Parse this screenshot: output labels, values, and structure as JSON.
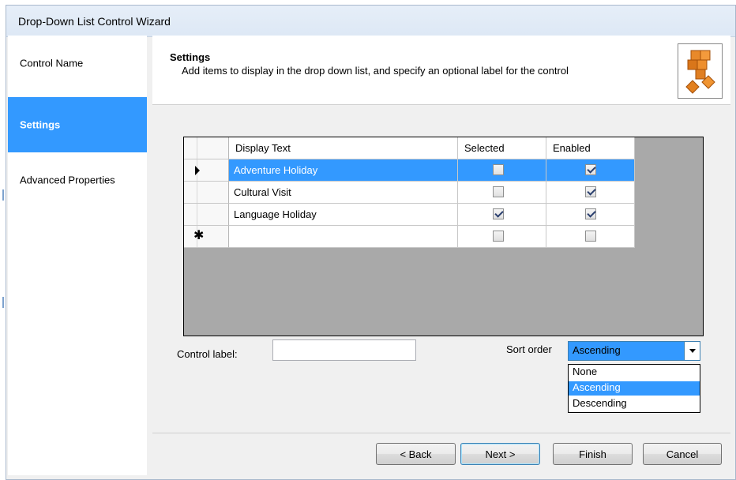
{
  "window": {
    "title": "Drop-Down List Control Wizard"
  },
  "sidebar": {
    "items": [
      {
        "label": "Control Name",
        "active": false
      },
      {
        "label": "Settings",
        "active": true
      },
      {
        "label": "Advanced Properties",
        "active": false
      }
    ]
  },
  "header": {
    "title": "Settings",
    "description": "Add items to display in the drop down list, and specify an optional label for the control",
    "icon": "blocks-icon"
  },
  "grid": {
    "columns": [
      "Display Text",
      "Selected",
      "Enabled"
    ],
    "rows": [
      {
        "text": "Adventure Holiday",
        "selected": false,
        "enabled": true,
        "current": true
      },
      {
        "text": "Cultural Visit",
        "selected": false,
        "enabled": true,
        "current": false
      },
      {
        "text": "Language Holiday",
        "selected": true,
        "enabled": true,
        "current": false
      }
    ],
    "new_row": {
      "text": "",
      "selected": false,
      "enabled": false
    }
  },
  "form": {
    "control_label": "Control label:",
    "control_label_value": "",
    "sort_order_label": "Sort order",
    "sort_order_value": "Ascending",
    "sort_options": [
      "None",
      "Ascending",
      "Descending"
    ],
    "highlighted_option": "Ascending"
  },
  "buttons": {
    "back": "< Back",
    "next": "Next >",
    "finish": "Finish",
    "cancel": "Cancel"
  },
  "colors": {
    "selection": "#3399ff",
    "grid_background": "#a9a9a9"
  }
}
